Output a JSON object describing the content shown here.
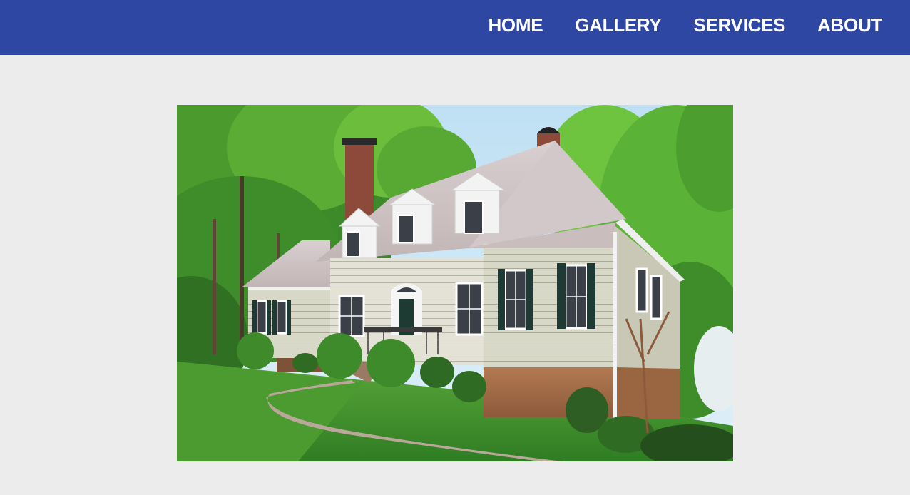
{
  "nav": {
    "items": [
      {
        "label": "HOME"
      },
      {
        "label": "GALLERY"
      },
      {
        "label": "SERVICES"
      },
      {
        "label": "ABOUT"
      }
    ]
  },
  "colors": {
    "navbar_bg": "#2d47a3",
    "page_bg": "#ececec",
    "nav_text": "#ffffff"
  }
}
